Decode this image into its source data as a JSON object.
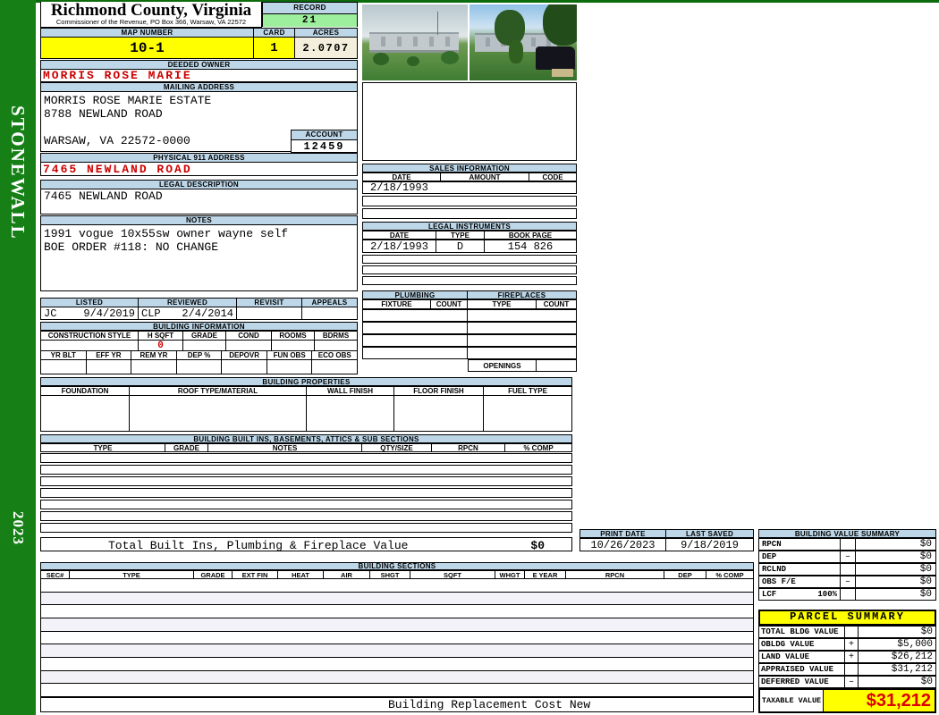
{
  "sidebar": {
    "district": "STONEWALL",
    "year": "2023"
  },
  "header": {
    "title": "Richmond County, Virginia",
    "subtitle": "Commissioner of the Revenue, PO Box 366, Warsaw, VA 22572",
    "record_label": "RECORD",
    "record_value": "21",
    "map_number_label": "MAP NUMBER",
    "map_number": "10-1",
    "card_label": "CARD",
    "card_value": "1",
    "acres_label": "ACRES",
    "acres_value": "2.0707"
  },
  "owner": {
    "deeded_owner_label": "DEEDED OWNER",
    "deeded_owner": "MORRIS ROSE MARIE",
    "mailing_address_label": "MAILING ADDRESS",
    "mailing_line1": "MORRIS ROSE MARIE ESTATE",
    "mailing_line2": "8788 NEWLAND ROAD",
    "mailing_line3": "WARSAW, VA 22572-0000",
    "account_label": "ACCOUNT",
    "account_value": "12459"
  },
  "address": {
    "physical_label": "PHYSICAL 911 ADDRESS",
    "physical_value": "7465 NEWLAND ROAD",
    "legal_label": "LEGAL DESCRIPTION",
    "legal_value": "7465 NEWLAND ROAD"
  },
  "notes": {
    "label": "NOTES",
    "line1": "1991 vogue 10x55sw owner wayne self",
    "line2": "BOE ORDER #118: NO CHANGE"
  },
  "review": {
    "listed_label": "LISTED",
    "reviewed_label": "REVIEWED",
    "revisit_label": "REVISIT",
    "appeals_label": "APPEALS",
    "listed_by": "JC",
    "listed_date": "9/4/2019",
    "reviewed_by": "CLP",
    "reviewed_date": "2/4/2014"
  },
  "building_information": {
    "title": "BUILDING INFORMATION",
    "row1_cols": [
      "CONSTRUCTION STYLE",
      "H SQFT",
      "GRADE",
      "COND",
      "ROOMS",
      "BDRMS"
    ],
    "h_sqft_value": "0",
    "row2_cols": [
      "YR BLT",
      "EFF YR",
      "REM YR",
      "DEP %",
      "DEPOVR",
      "FUN OBS",
      "ECO OBS"
    ]
  },
  "building_properties": {
    "title": "BUILDING PROPERTIES",
    "cols": [
      "FOUNDATION",
      "ROOF TYPE/MATERIAL",
      "WALL FINISH",
      "FLOOR FINISH",
      "FUEL TYPE"
    ]
  },
  "built_ins": {
    "title": "BUILDING BUILT INS, BASEMENTS, ATTICS & SUB SECTIONS",
    "cols": [
      "TYPE",
      "GRADE",
      "NOTES",
      "QTY/SIZE",
      "RPCN",
      "% COMP"
    ],
    "total_label": "Total Built Ins, Plumbing & Fireplace Value",
    "total_value": "$0"
  },
  "sales": {
    "title": "SALES INFORMATION",
    "cols": [
      "DATE",
      "AMOUNT",
      "CODE"
    ],
    "row1_date": "2/18/1993"
  },
  "instruments": {
    "title": "LEGAL INSTRUMENTS",
    "cols": [
      "DATE",
      "TYPE",
      "BOOK PAGE"
    ],
    "row1": {
      "date": "2/18/1993",
      "type": "D",
      "book_page": "154 826"
    }
  },
  "plumbing": {
    "title": "PLUMBING",
    "cols": [
      "FIXTURE",
      "COUNT"
    ]
  },
  "fireplaces": {
    "title": "FIREPLACES",
    "cols": [
      "TYPE",
      "COUNT"
    ],
    "openings_label": "OPENINGS"
  },
  "print_block": {
    "print_date_label": "PRINT DATE",
    "print_date": "10/26/2023",
    "last_saved_label": "LAST SAVED",
    "last_saved": "9/18/2019"
  },
  "building_value_summary": {
    "title": "BUILDING VALUE SUMMARY",
    "rows": [
      {
        "label": "RPCN",
        "pct": "",
        "op": "",
        "value": "$0"
      },
      {
        "label": "DEP",
        "pct": "",
        "op": "–",
        "value": "$0"
      },
      {
        "label": "RCLND",
        "pct": "",
        "op": "",
        "value": "$0"
      },
      {
        "label": "OBS F/E",
        "pct": "",
        "op": "–",
        "value": "$0"
      },
      {
        "label": "LCF",
        "pct": "100%",
        "op": "",
        "value": "$0"
      }
    ]
  },
  "building_sections": {
    "title": "BUILDING SECTIONS",
    "cols": [
      "SEC#",
      "TYPE",
      "GRADE",
      "EXT FIN",
      "HEAT",
      "AIR",
      "SHGT",
      "SQFT",
      "WHGT",
      "E YEAR",
      "RPCN",
      "DEP",
      "% COMP"
    ],
    "footer": "Building Replacement Cost New"
  },
  "parcel_summary": {
    "title": "PARCEL SUMMARY",
    "rows": [
      {
        "label": "TOTAL BLDG VALUE",
        "op": "",
        "value": "$0"
      },
      {
        "label": "OBLDG VALUE",
        "op": "+",
        "value": "$5,000"
      },
      {
        "label": "LAND VALUE",
        "op": "+",
        "value": "$26,212"
      },
      {
        "label": "APPRAISED VALUE",
        "op": "",
        "value": "$31,212"
      },
      {
        "label": "DEFERRED VALUE",
        "op": "–",
        "value": "$0"
      }
    ],
    "taxable_label": "TAXABLE VALUE",
    "taxable_value": "$31,212"
  },
  "colors": {
    "header_blue": "#bdd7e8",
    "sidebar_green": "#168016",
    "record_green": "#9dee9d",
    "highlight_yellow": "#ffff00",
    "acres_cream": "#f3efdc",
    "alert_red": "#cc0000"
  }
}
